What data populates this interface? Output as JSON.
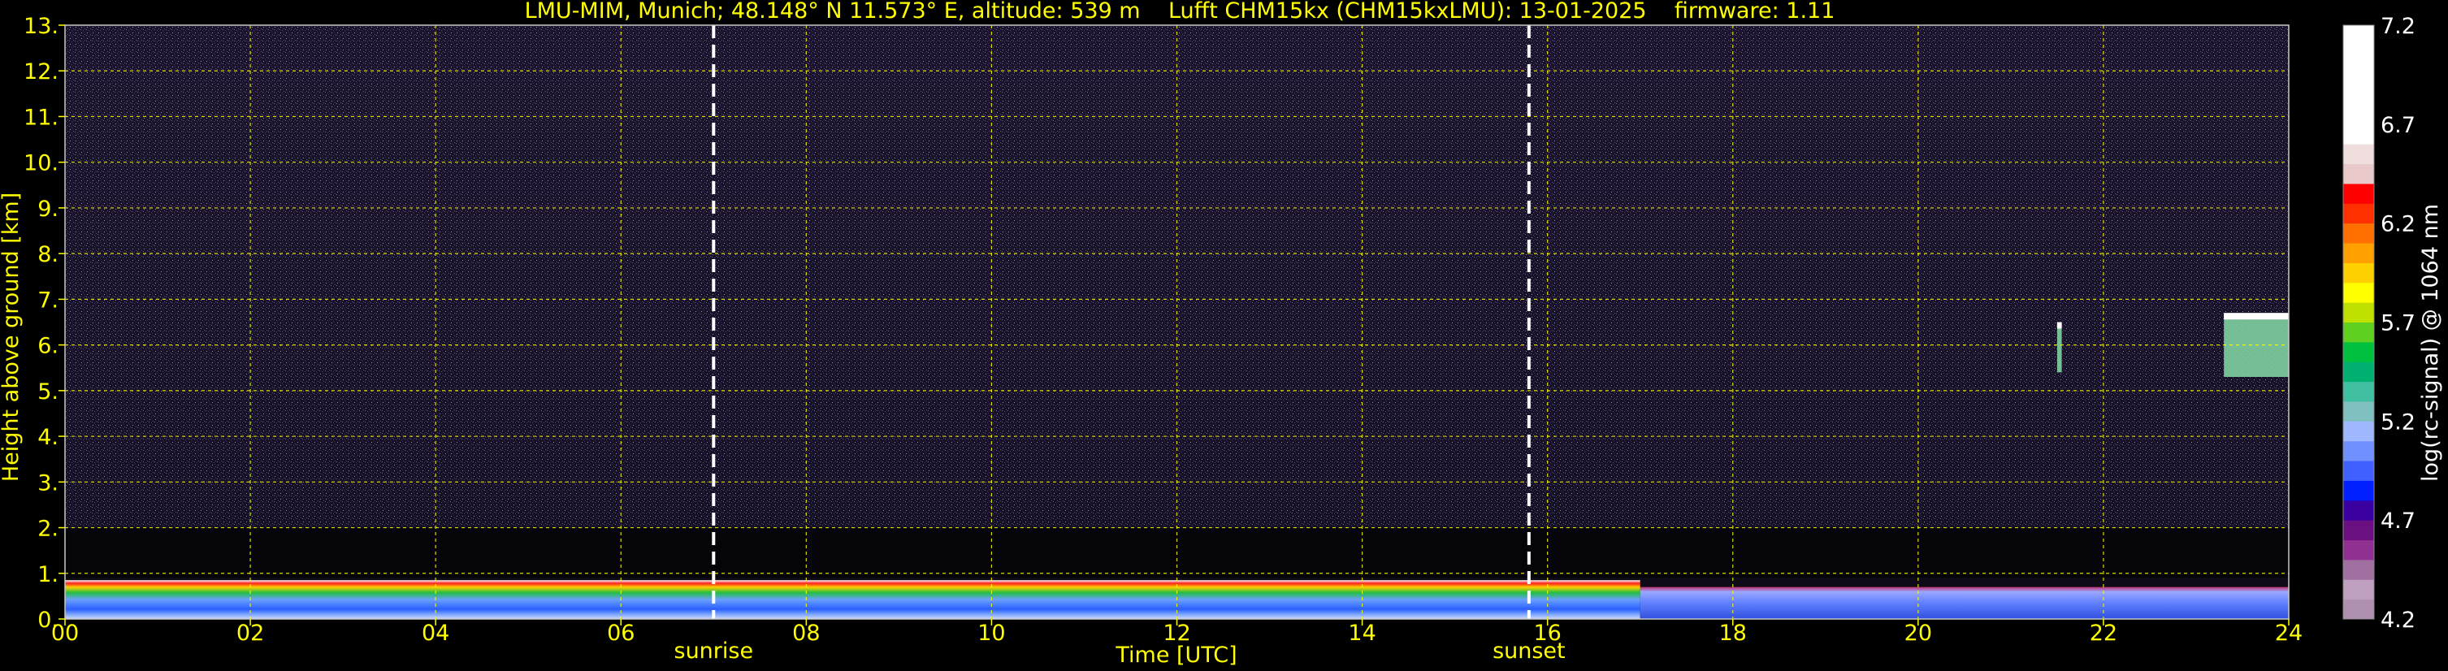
{
  "chart_data": {
    "type": "heatmap",
    "title": "LMU-MIM, Munich; 48.148° N 11.573° E, altitude: 539 m    Lufft CHM15kx (CHM15kxLMU): 13-01-2025    firmware: 1.11",
    "xlabel": "Time [UTC]",
    "ylabel": "Height above ground [km]",
    "xlim": [
      0,
      24
    ],
    "ylim": [
      0,
      13
    ],
    "x_ticks": [
      "00",
      "02",
      "04",
      "06",
      "08",
      "10",
      "12",
      "14",
      "16",
      "18",
      "20",
      "22",
      "24"
    ],
    "y_ticks": [
      "0.",
      "1.",
      "2.",
      "3.",
      "4.",
      "5.",
      "6.",
      "7.",
      "8.",
      "9.",
      "10.",
      "11.",
      "12.",
      "13."
    ],
    "grid": true,
    "events": [
      {
        "label": "sunrise",
        "time_h": 7.0
      },
      {
        "label": "sunset",
        "time_h": 15.8
      }
    ],
    "colorbar": {
      "label": "log(rc-signal) @ 1064 nm",
      "min": 4.2,
      "max": 7.2,
      "ticks": [
        "7.2",
        "6.7",
        "6.2",
        "5.7",
        "5.2",
        "4.7",
        "4.2"
      ]
    },
    "features": [
      {
        "name": "boundary layer aerosol",
        "t_start": 0,
        "t_end": 24,
        "top_km": 0.85
      },
      {
        "name": "cloud",
        "t_start": 21.5,
        "t_end": 21.55,
        "base_km": 5.4,
        "top_km": 6.5
      },
      {
        "name": "cloud",
        "t_start": 23.3,
        "t_end": 24,
        "base_km": 5.3,
        "top_km": 6.7
      }
    ]
  },
  "colors": {
    "background": "#000000",
    "text": "#ffff00",
    "grid": "#ffff00",
    "event_line": "#ffffff"
  }
}
